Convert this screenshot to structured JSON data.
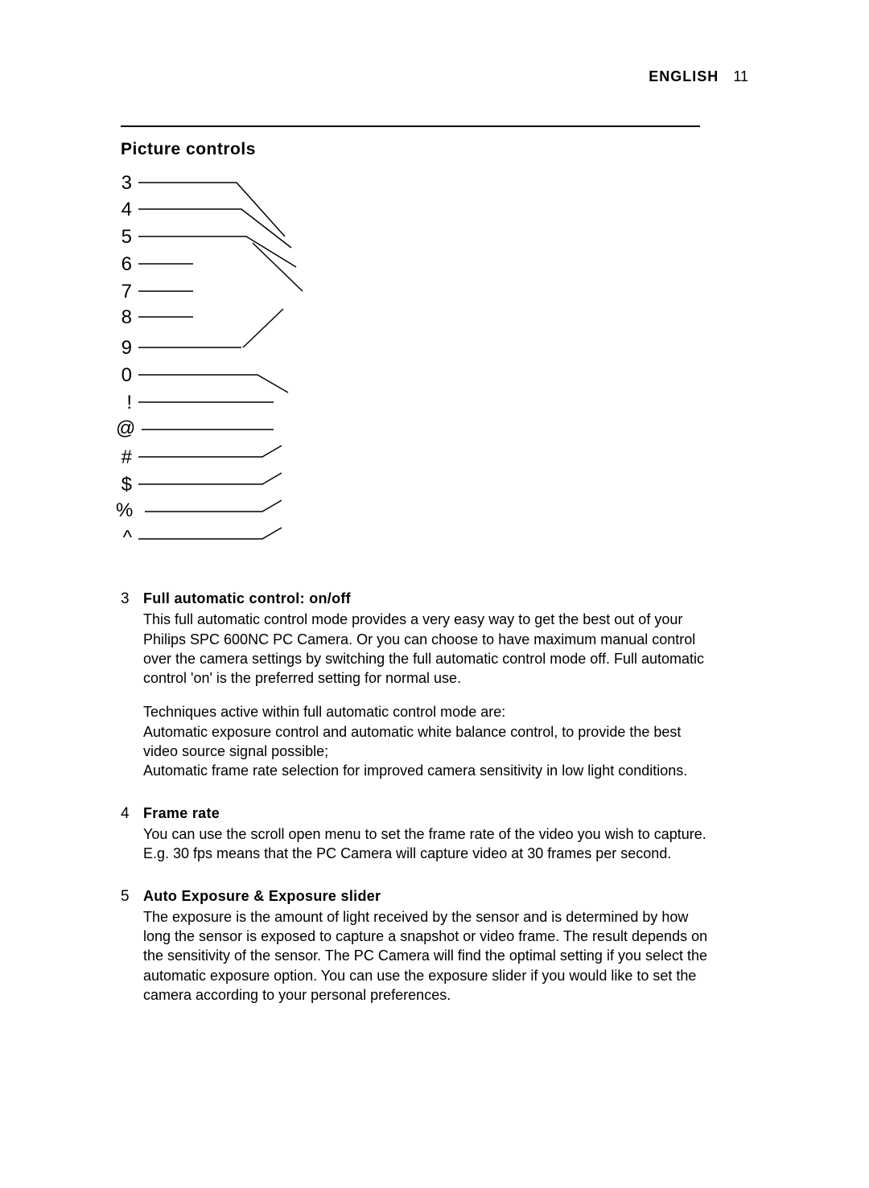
{
  "header": {
    "lang": "ENGLISH",
    "page": "11"
  },
  "section_title": "Picture controls",
  "diagram": {
    "labels": [
      "3",
      "4",
      "5",
      "6",
      "7",
      "8",
      "9",
      "0",
      "!",
      "@",
      "#",
      "$",
      "%",
      "^"
    ]
  },
  "entries": [
    {
      "num": "3",
      "title": "Full automatic control: on/off",
      "paras": [
        "This full automatic control mode provides a very easy way to get the best out of your Philips SPC 600NC PC Camera. Or you can choose to have maximum manual control over the camera settings by switching the full automatic control mode off. Full automatic control 'on' is the preferred setting for normal use.",
        "Techniques active within full automatic control mode are:",
        "Automatic exposure control and automatic white balance control, to provide the best video source signal possible;",
        "Automatic frame rate selection for improved camera sensitivity in low light conditions."
      ]
    },
    {
      "num": "4",
      "title": "Frame rate",
      "paras": [
        "You can use the scroll open menu to set the frame rate of the video you wish to capture. E.g. 30 fps means that the PC Camera will capture video at 30 frames per second."
      ]
    },
    {
      "num": "5",
      "title": "Auto Exposure & Exposure slider",
      "paras": [
        "The exposure is the amount of light received by the sensor and is determined by how long the sensor is exposed to capture a snapshot or video frame. The result depends on the sensitivity of the sensor. The PC Camera will find the optimal setting if you select the automatic exposure option. You can use the exposure slider if you would like to set the camera according to your personal preferences."
      ]
    }
  ]
}
